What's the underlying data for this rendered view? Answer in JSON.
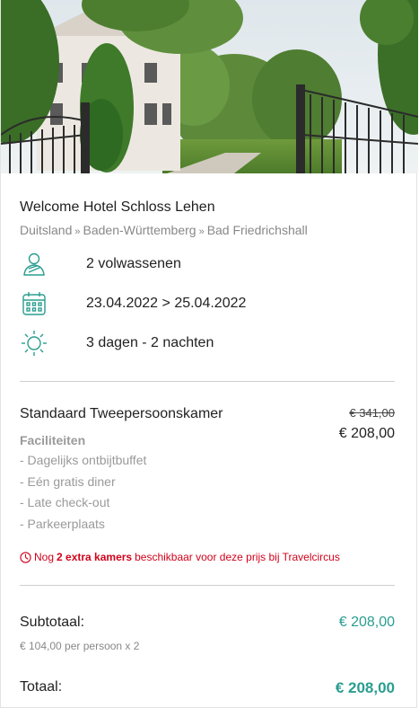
{
  "hotel": {
    "name": "Welcome Hotel Schloss Lehen",
    "breadcrumb": [
      "Duitsland",
      "Baden-Württemberg",
      "Bad Friedrichshall"
    ],
    "breadcrumb_sep": "»"
  },
  "info": {
    "guests": {
      "icon": "person-icon",
      "text": "2 volwassenen"
    },
    "dates": {
      "icon": "calendar-icon",
      "text": "23.04.2022 > 25.04.2022"
    },
    "duration": {
      "icon": "sun-icon",
      "text": "3 dagen - 2 nachten"
    }
  },
  "room": {
    "name": "Standaard Tweepersoonskamer",
    "old_price": "€ 341,00",
    "price": "€ 208,00",
    "facilities_title": "Faciliteiten",
    "facilities": [
      "- Dagelijks ontbijtbuffet",
      "- Eén gratis diner",
      "- Late check-out",
      "- Parkeerplaats"
    ],
    "availability": {
      "prefix": "Nog",
      "highlight": "2 extra kamers",
      "suffix": "beschikbaar voor deze prijs bij Travelcircus"
    }
  },
  "summary": {
    "subtotal_label": "Subtotaal:",
    "subtotal_value": "€ 208,00",
    "subtotal_detail": "€ 104,00 per persoon x 2",
    "total_label": "Totaal:",
    "total_value": "€ 208,00"
  },
  "colors": {
    "accent": "#2a9d8f",
    "alert": "#d0021b",
    "muted": "#9a9a9a"
  }
}
